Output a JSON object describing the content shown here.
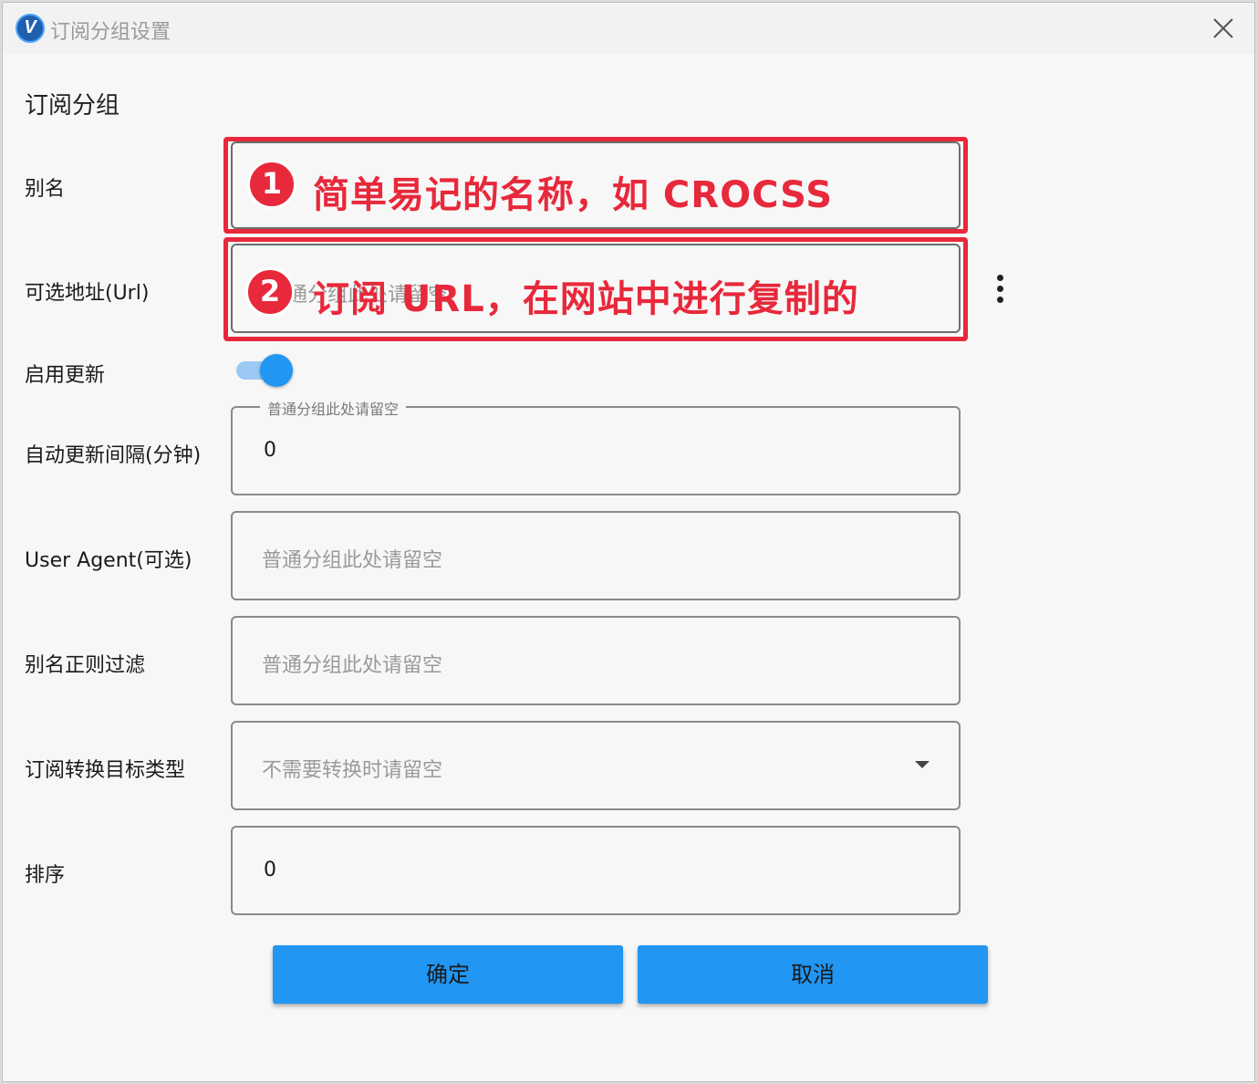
{
  "window": {
    "title": "订阅分组设置",
    "logo_letter": "V"
  },
  "section_title": "订阅分组",
  "fields": {
    "alias": {
      "label": "别名"
    },
    "url": {
      "label": "可选地址(Url)",
      "placeholder_partial": "通分组此处请留空"
    },
    "enable_update": {
      "label": "启用更新",
      "enabled": true
    },
    "auto_update_interval": {
      "label": "自动更新间隔(分钟)",
      "floating_label": "普通分组此处请留空",
      "value": "0"
    },
    "user_agent": {
      "label": "User Agent(可选)",
      "placeholder": "普通分组此处请留空"
    },
    "alias_regex": {
      "label": "别名正则过滤",
      "placeholder": "普通分组此处请留空"
    },
    "convert_target": {
      "label": "订阅转换目标类型",
      "placeholder": "不需要转换时请留空"
    },
    "sort": {
      "label": "排序",
      "value": "0"
    }
  },
  "annotations": [
    {
      "number": "1",
      "text": "简单易记的名称，如 CROCSS"
    },
    {
      "number": "2",
      "text": "订阅 URL，在网站中进行复制的"
    }
  ],
  "buttons": {
    "confirm": "确定",
    "cancel": "取消"
  },
  "colors": {
    "accent": "#2196f3",
    "annotation": "#e8283b"
  },
  "icons": {
    "close": "close-icon",
    "more": "more-vertical-icon",
    "dropdown": "chevron-down-icon"
  }
}
